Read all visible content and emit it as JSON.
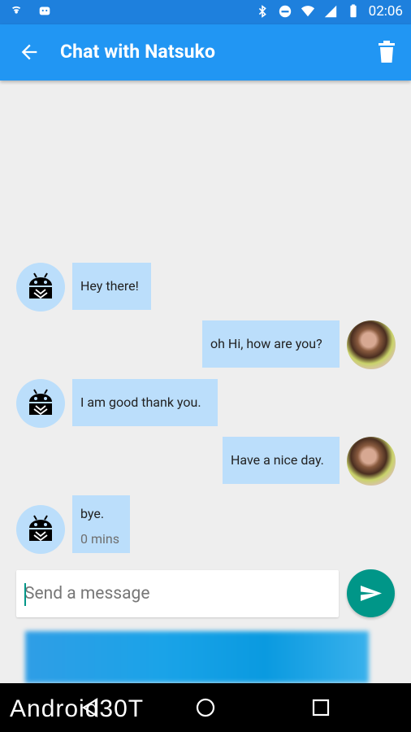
{
  "status_bar": {
    "time": "02:06"
  },
  "app_bar": {
    "title": "Chat with Natsuko"
  },
  "messages": [
    {
      "from": "bot",
      "text": "Hey there!"
    },
    {
      "from": "user",
      "text": "oh Hi, how are you?"
    },
    {
      "from": "bot",
      "text": "I am good thank you."
    },
    {
      "from": "user",
      "text": "Have a nice day."
    },
    {
      "from": "bot",
      "text": "bye.",
      "meta": "0 mins"
    }
  ],
  "composer": {
    "placeholder": "Send a message",
    "value": ""
  },
  "watermark": "Android30T",
  "colors": {
    "app_bar": "#2196f3",
    "status_bar": "#1e80dd",
    "bubble": "#bbdefb",
    "send": "#009688"
  }
}
